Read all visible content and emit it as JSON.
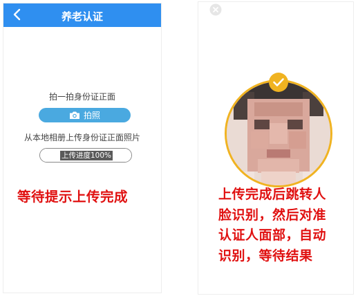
{
  "left_screen": {
    "title": "养老认证",
    "back_icon": "chevron-left-icon",
    "header_color": "#2f8ff0",
    "front_photo_hint": "拍一拍身份证正面",
    "photo_button": {
      "icon": "camera-icon",
      "label": "拍照",
      "color": "#4aa9e0"
    },
    "album_hint": "从本地相册上传身份证正面照片",
    "upload_progress": {
      "label": "上传进度100%",
      "percent": 100
    },
    "caption": "等待提示上传完成"
  },
  "right_screen": {
    "close_icon": "close-icon",
    "check_icon": "checkmark-badge-icon",
    "frame_color": "#f0b321",
    "caption_lines": [
      "上传完成后跳转人",
      "脸识别，然后对准",
      "认证人面部，自动",
      "识别，等待结果"
    ]
  },
  "caption_color": "#e01010"
}
